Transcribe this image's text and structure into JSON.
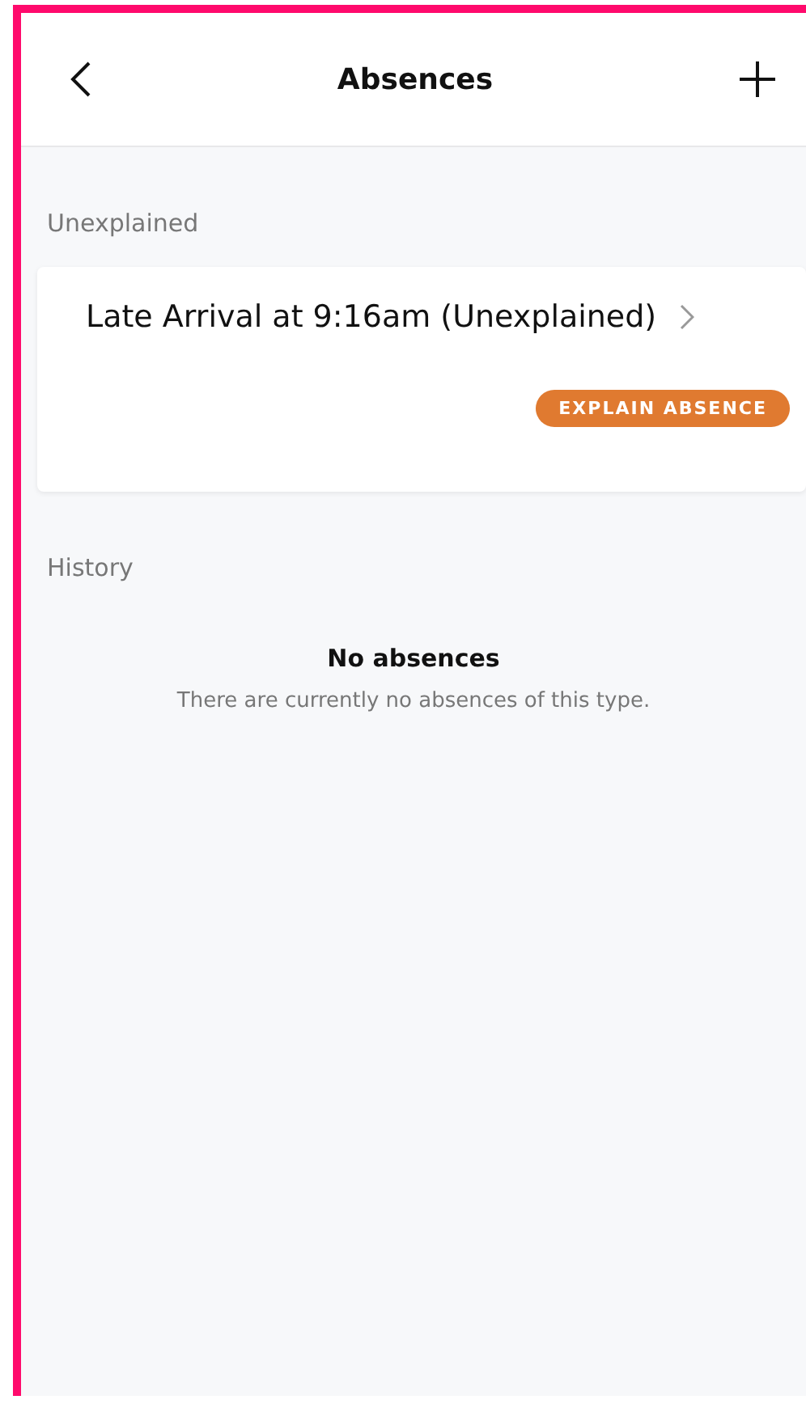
{
  "header": {
    "title": "Absences"
  },
  "sections": [
    {
      "title": "Unexplained",
      "items": [
        {
          "title": "Late Arrival at 9:16am (Unexplained)",
          "action": "EXPLAIN ABSENCE"
        }
      ]
    },
    {
      "title": "History",
      "empty": {
        "title": "No absences",
        "message": "There are currently no absences of this type."
      }
    }
  ]
}
